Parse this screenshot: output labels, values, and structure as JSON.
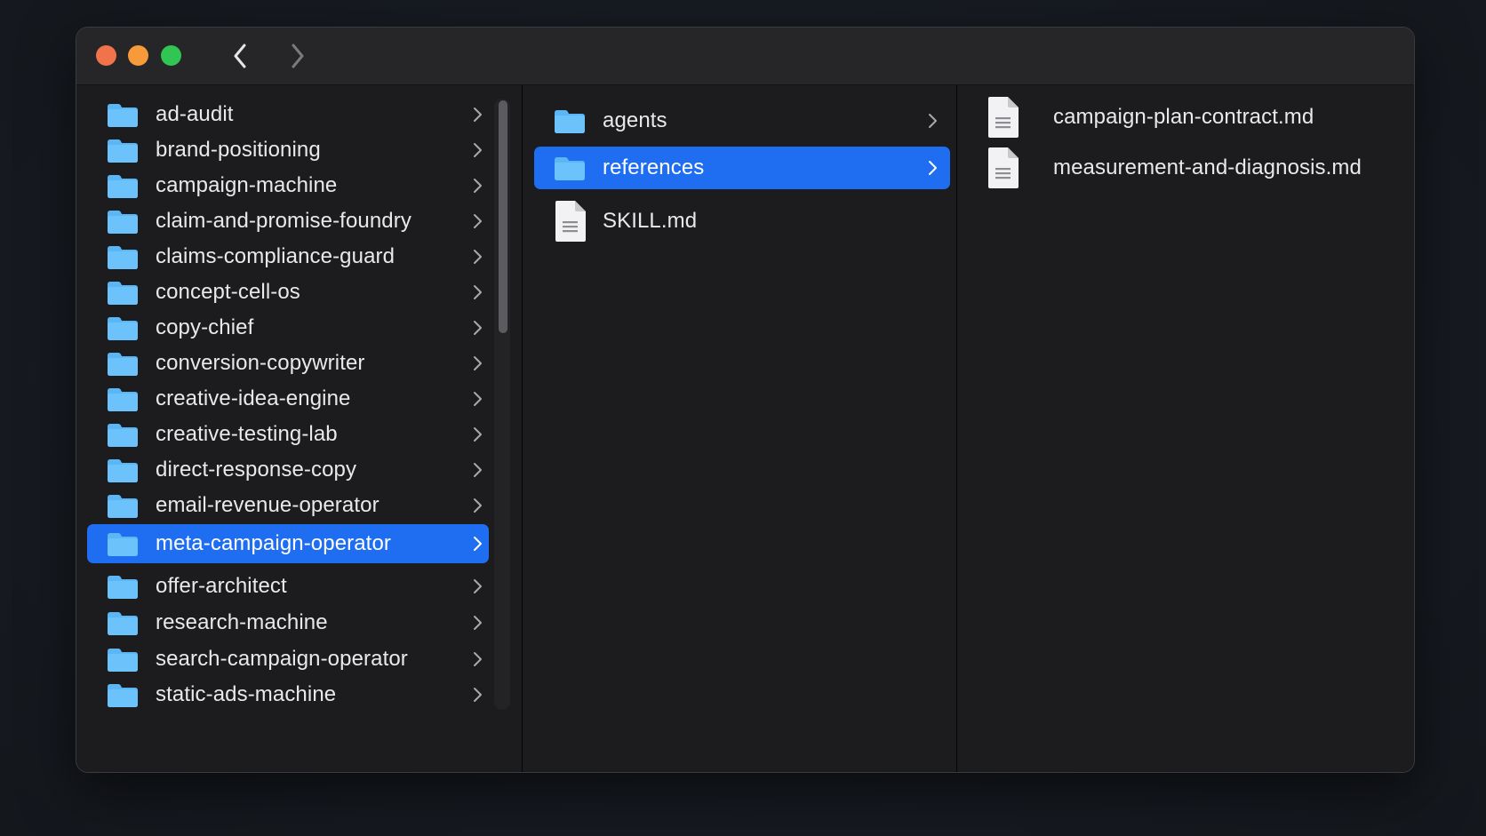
{
  "window": {
    "traffic_lights": {
      "close_color": "#f1734b",
      "minimize_color": "#f79a3a",
      "maximize_color": "#31c653"
    },
    "nav": {
      "back_icon": "chevron-left-icon",
      "forward_icon": "chevron-right-icon"
    }
  },
  "colors": {
    "selection": "#1f6ef1",
    "folder": "#5bb6f5",
    "window_bg": "#1c1c1e"
  },
  "column1": {
    "items": [
      {
        "label": "ad-audit",
        "type": "folder",
        "selected": false
      },
      {
        "label": "brand-positioning",
        "type": "folder",
        "selected": false
      },
      {
        "label": "campaign-machine",
        "type": "folder",
        "selected": false
      },
      {
        "label": "claim-and-promise-foundry",
        "type": "folder",
        "selected": false
      },
      {
        "label": "claims-compliance-guard",
        "type": "folder",
        "selected": false
      },
      {
        "label": "concept-cell-os",
        "type": "folder",
        "selected": false
      },
      {
        "label": "copy-chief",
        "type": "folder",
        "selected": false
      },
      {
        "label": "conversion-copywriter",
        "type": "folder",
        "selected": false
      },
      {
        "label": "creative-idea-engine",
        "type": "folder",
        "selected": false
      },
      {
        "label": "creative-testing-lab",
        "type": "folder",
        "selected": false
      },
      {
        "label": "direct-response-copy",
        "type": "folder",
        "selected": false
      },
      {
        "label": "email-revenue-operator",
        "type": "folder",
        "selected": false
      },
      {
        "label": "meta-campaign-operator",
        "type": "folder",
        "selected": true
      },
      {
        "label": "offer-architect",
        "type": "folder",
        "selected": false
      },
      {
        "label": "research-machine",
        "type": "folder",
        "selected": false
      },
      {
        "label": "search-campaign-operator",
        "type": "folder",
        "selected": false
      },
      {
        "label": "static-ads-machine",
        "type": "folder",
        "selected": false
      }
    ]
  },
  "column2": {
    "items": [
      {
        "label": "agents",
        "type": "folder",
        "selected": false
      },
      {
        "label": "references",
        "type": "folder",
        "selected": true
      },
      {
        "label": "SKILL.md",
        "type": "file",
        "selected": false
      }
    ]
  },
  "column3": {
    "items": [
      {
        "label": "campaign-plan-contract.md",
        "type": "file"
      },
      {
        "label": "measurement-and-diagnosis.md",
        "type": "file"
      }
    ]
  }
}
